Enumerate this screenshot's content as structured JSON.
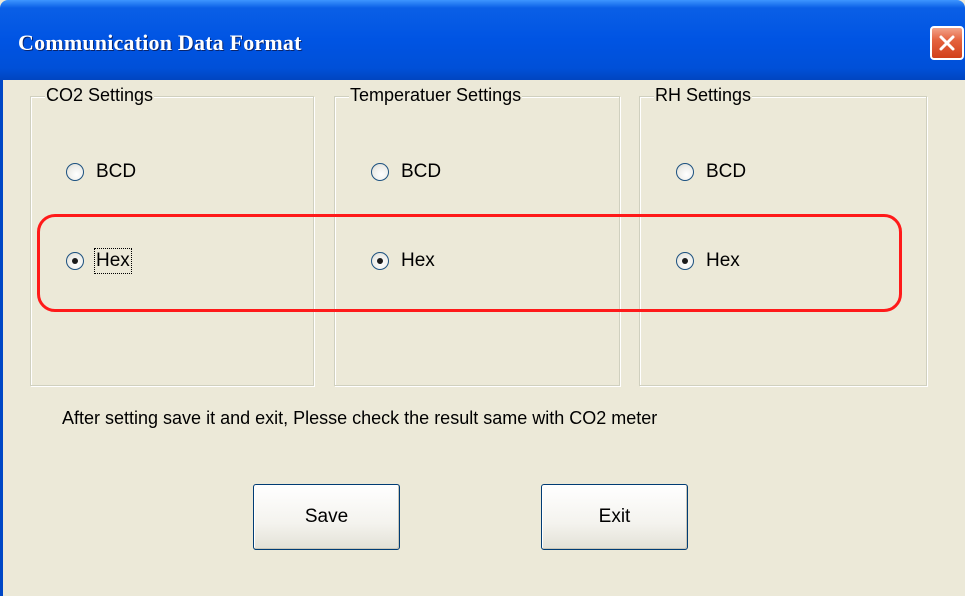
{
  "window": {
    "title": "Communication Data Format"
  },
  "groups": [
    {
      "label": "CO2 Settings",
      "options": [
        {
          "label": "BCD",
          "checked": false
        },
        {
          "label": "Hex",
          "checked": true
        }
      ]
    },
    {
      "label": "Temperatuer Settings",
      "options": [
        {
          "label": "BCD",
          "checked": false
        },
        {
          "label": "Hex",
          "checked": true
        }
      ]
    },
    {
      "label": "RH Settings",
      "options": [
        {
          "label": "BCD",
          "checked": false
        },
        {
          "label": "Hex",
          "checked": true
        }
      ]
    }
  ],
  "note": "After setting save it and exit, Plesse check the result same with CO2 meter",
  "buttons": {
    "save_label": "Save",
    "exit_label": "Exit"
  },
  "colors": {
    "title_bar": "#0054e3",
    "highlight": "#ff1a1a",
    "face": "#ece9d8"
  },
  "icons": {
    "close": "close-icon"
  }
}
